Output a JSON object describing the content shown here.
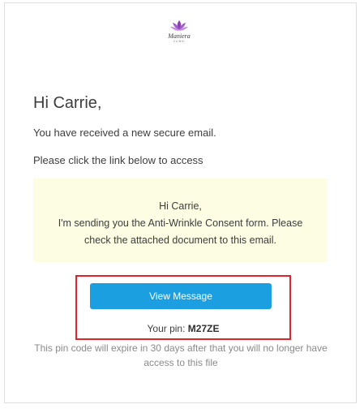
{
  "logo": {
    "icon": "lotus-icon",
    "brand": "Maniera",
    "tagline": "CLINIC",
    "color": "#8b3fb5"
  },
  "email": {
    "greeting": "Hi Carrie,",
    "line1": "You have received a new secure email.",
    "line2": "Please click the link below to access",
    "message_lines": [
      "Hi Carrie,",
      "I'm sending you the Anti-Wrinkle Consent form. Please",
      "check the attached document to this email."
    ],
    "button_label": "View Message",
    "pin_label": "Your pin:",
    "pin_value": "M27ZE",
    "expiry_note": "This pin code will expire in 30 days after that you will no longer have access to this file"
  },
  "colors": {
    "button": "#1c9fe0",
    "highlight_border": "#e3232b",
    "note_background": "#fcfde3"
  }
}
